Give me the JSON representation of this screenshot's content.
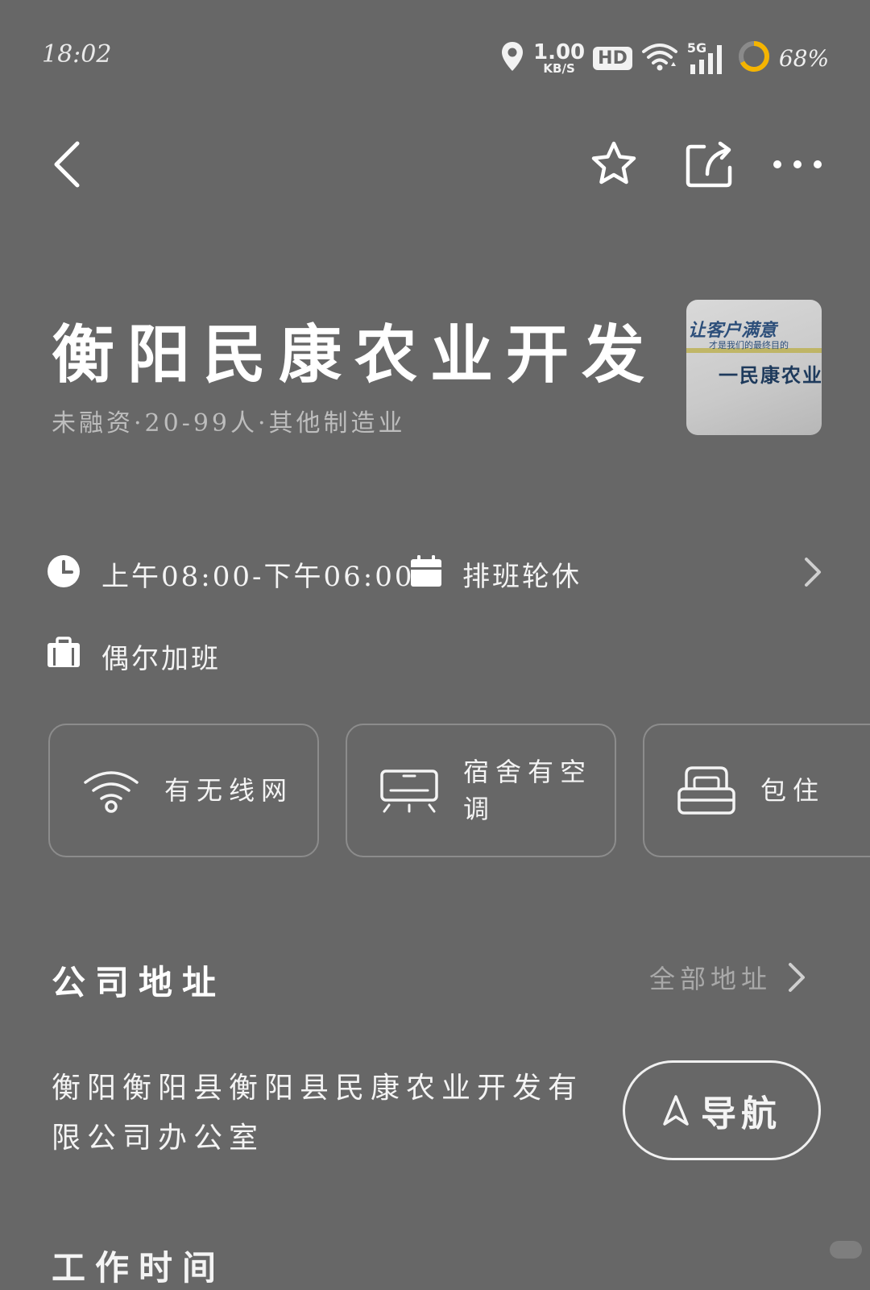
{
  "status_bar": {
    "time": "18:02",
    "net_speed_value": "1.00",
    "net_speed_unit": "KB/S",
    "hd_badge": "HD",
    "signal_label": "5G",
    "battery": "68%",
    "icons": [
      "location-icon",
      "wifi-icon",
      "signal-icon",
      "battery-ring-icon"
    ]
  },
  "top_nav": {
    "icons": [
      "back-icon",
      "star-icon",
      "share-icon",
      "more-icon"
    ]
  },
  "company": {
    "name": "衡阳民康农业开发",
    "meta": "未融资·20-99人·其他制造业",
    "logo_text": {
      "line1": "让客户满意",
      "line2": "才是我们的最终目的",
      "line3": "一民康农业"
    }
  },
  "work_info": {
    "hours": "上午08:00-下午06:00",
    "schedule": "排班轮休",
    "overtime": "偶尔加班"
  },
  "benefits": [
    {
      "label": "有无线网",
      "icon": "wifi-icon"
    },
    {
      "label": "宿舍有空调",
      "icon": "air-conditioner-icon"
    },
    {
      "label": "包住",
      "icon": "bed-icon"
    }
  ],
  "address": {
    "section_title": "公司地址",
    "all_address_label": "全部地址",
    "text": "衡阳衡阳县衡阳县民康农业开发有限公司办公室",
    "navigate_label": "导航"
  },
  "next_section_title": "工作时间",
  "colors": {
    "background": "#676767",
    "battery_ring": "#f5b400",
    "text": "#ffffff",
    "muted": "#bdbdbd",
    "card_border": "#8c8c8c"
  }
}
